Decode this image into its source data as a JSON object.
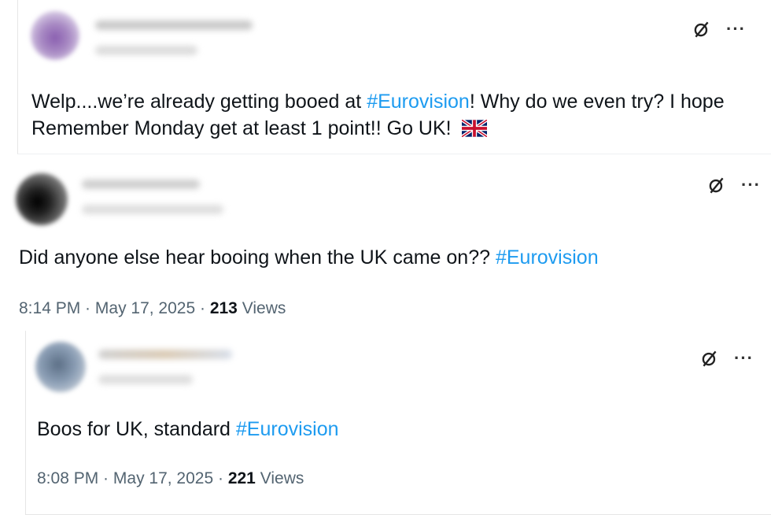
{
  "tweets": [
    {
      "text_before": "Welp....we’re already getting booed at ",
      "hashtag": "#Eurovision",
      "text_after": "! Why do we even try? I hope Remember Monday get at least 1 point!! Go UK! ",
      "flag_icon": "uk-flag-icon",
      "avatar_color": "#8a5fb0"
    },
    {
      "text_before": "Did anyone else hear booing when the UK came on?? ",
      "hashtag": "#Eurovision",
      "time": "8:14 PM",
      "date": "May 17, 2025",
      "views_count": "213",
      "views_label": "Views",
      "avatar_color": "#1a1a1a"
    },
    {
      "text_before": "Boos for UK, standard ",
      "hashtag": "#Eurovision",
      "time": "8:08 PM",
      "date": "May 17, 2025",
      "views_count": "221",
      "views_label": "Views",
      "avatar_color": "#7a8fa8"
    }
  ],
  "separator": " · ",
  "more_glyph": "···",
  "icons": [
    "grok-icon",
    "more-icon"
  ],
  "colors": {
    "hashtag": "#1d9bf0",
    "meta": "#536471",
    "text": "#0f1419"
  }
}
